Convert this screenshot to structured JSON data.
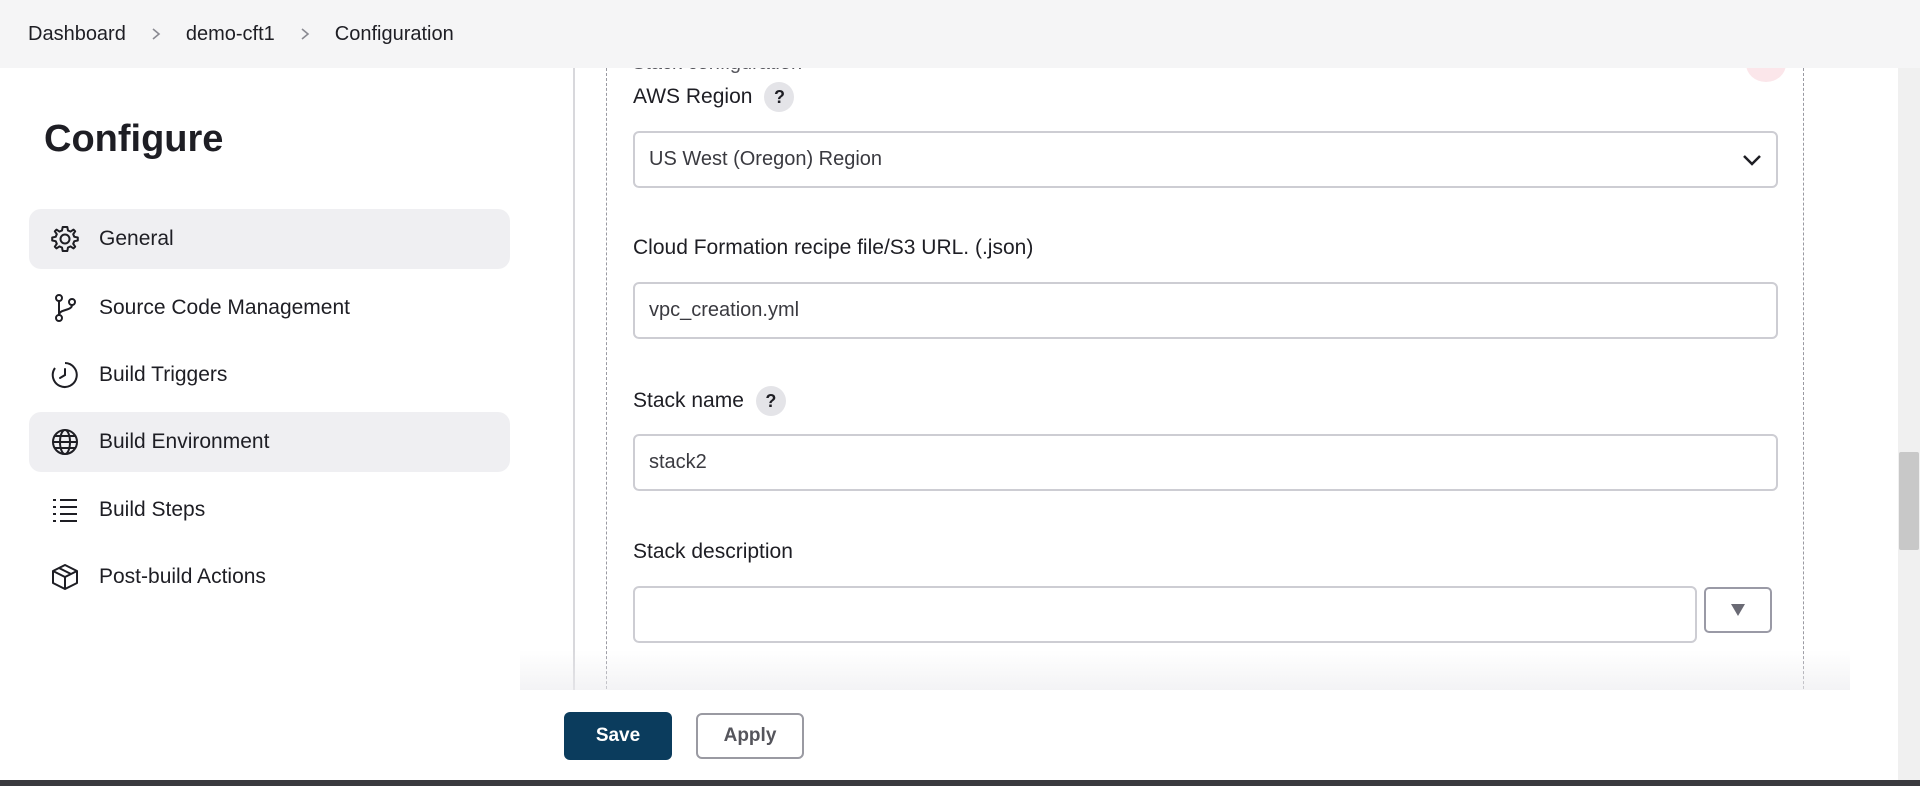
{
  "breadcrumb": [
    "Dashboard",
    "demo-cft1",
    "Configuration"
  ],
  "page_title": "Configure",
  "nav": [
    {
      "label": "General",
      "icon": "gear-icon",
      "active": true
    },
    {
      "label": "Source Code Management",
      "icon": "branch-icon",
      "active": false
    },
    {
      "label": "Build Triggers",
      "icon": "clock-icon",
      "active": false
    },
    {
      "label": "Build Environment",
      "icon": "globe-icon",
      "active": true
    },
    {
      "label": "Build Steps",
      "icon": "list-icon",
      "active": false
    },
    {
      "label": "Post-build Actions",
      "icon": "package-icon",
      "active": false
    }
  ],
  "section": {
    "title": "Stack configuration",
    "region": {
      "label": "AWS Region",
      "help": "?",
      "value": "US West (Oregon) Region"
    },
    "recipe": {
      "label": "Cloud Formation recipe file/S3 URL. (.json)",
      "value": "vpc_creation.yml"
    },
    "stack_name": {
      "label": "Stack name",
      "help": "?",
      "value": "stack2"
    },
    "stack_description": {
      "label": "Stack description",
      "value": ""
    }
  },
  "buttons": {
    "save": "Save",
    "apply": "Apply"
  },
  "colors": {
    "primary": "#0b3c5d",
    "active_nav": "#efeff2"
  }
}
